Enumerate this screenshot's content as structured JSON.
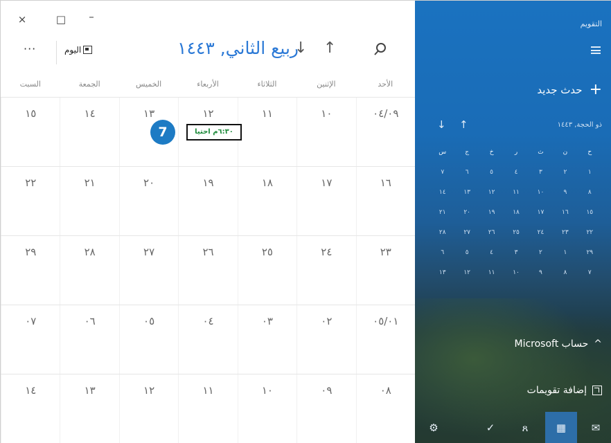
{
  "window": {
    "close": "×",
    "maximize": "□",
    "minimize": "–"
  },
  "toolbar": {
    "more": "···",
    "today_label": "اليوم",
    "month_title": "ربيع الثاني, ١٤٤٣",
    "down_arrow": "↓",
    "up_arrow": "↑"
  },
  "weekdays": [
    "الأحد",
    "الإثنين",
    "الثلاثاء",
    "الأربعاء",
    "الخميس",
    "الجمعة",
    "السبت"
  ],
  "weeks": [
    [
      "٠٤/٠٩",
      "١٠",
      "١١",
      "١٢",
      "١٣",
      "١٤",
      "١٥"
    ],
    [
      "١٦",
      "١٧",
      "١٨",
      "١٩",
      "٢٠",
      "٢١",
      "٢٢"
    ],
    [
      "٢٣",
      "٢٤",
      "٢٥",
      "٢٦",
      "٢٧",
      "٢٨",
      "٢٩"
    ],
    [
      "٠٥/٠١",
      "٠٢",
      "٠٣",
      "٠٤",
      "٠٥",
      "٠٦",
      "٠٧"
    ],
    [
      "٠٨",
      "٠٩",
      "١٠",
      "١١",
      "١٢",
      "١٣",
      "١٤"
    ]
  ],
  "event": {
    "label": "٦:٣٠م احتيا",
    "badge": "7"
  },
  "sidebar": {
    "title": "التقويم",
    "new_event": "حدث جديد",
    "new_event_icon": "+",
    "mini_month": "ذو الحجة, ١٤٤٣",
    "mini_up": "↑",
    "mini_down": "↓",
    "mini_weekdays": [
      "ح",
      "ن",
      "ث",
      "ر",
      "خ",
      "ج",
      "س"
    ],
    "mini_weeks": [
      [
        "١",
        "٢",
        "٣",
        "٤",
        "٥",
        "٦",
        "٧"
      ],
      [
        "٨",
        "٩",
        "١٠",
        "١١",
        "١٢",
        "١٣",
        "١٤"
      ],
      [
        "١٥",
        "١٦",
        "١٧",
        "١٨",
        "١٩",
        "٢٠",
        "٢١"
      ],
      [
        "٢٢",
        "٢٣",
        "٢٤",
        "٢٥",
        "٢٦",
        "٢٧",
        "٢٨"
      ],
      [
        "٢٩",
        "١",
        "٢",
        "٣",
        "٤",
        "٥",
        "٦"
      ],
      [
        "٧",
        "٨",
        "٩",
        "١٠",
        "١١",
        "١٢",
        "١٣"
      ]
    ],
    "account": "حساب Microsoft",
    "account_chevron": "^",
    "add_calendars": "إضافة تقويمات"
  },
  "bottom_nav": {
    "mail": "✉",
    "calendar": "▦",
    "people": "ጸ",
    "todo": "✓",
    "settings": "⚙"
  }
}
